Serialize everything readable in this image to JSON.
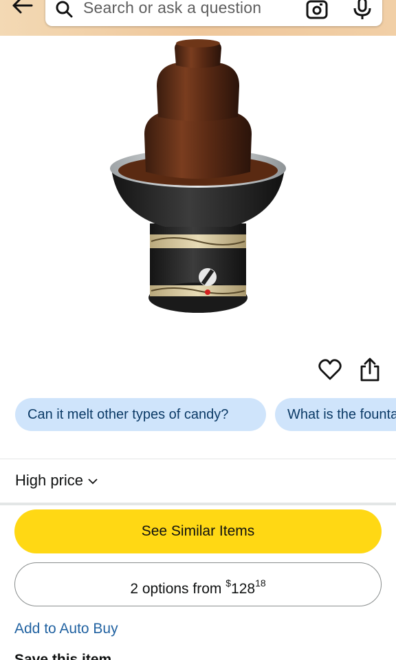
{
  "header": {
    "search_placeholder": "Search or ask a question"
  },
  "chips": [
    {
      "label": "Can it melt other types of candy?"
    },
    {
      "label": "What is the fountain"
    }
  ],
  "price_filter": {
    "label": "High price"
  },
  "buttons": {
    "see_similar": "See Similar Items",
    "options_prefix": "2 options from ",
    "options_currency": "$",
    "options_whole": "128",
    "options_fraction": "18"
  },
  "links": {
    "auto_buy": "Add to Auto Buy",
    "save_item": "Save this item"
  },
  "colors": {
    "header": "#efc79b",
    "chip": "#cfe4fb",
    "primary_button": "#ffd814",
    "link": "#2162a1"
  },
  "icons": [
    "back-arrow-icon",
    "search-icon",
    "camera-icon",
    "mic-icon",
    "heart-icon",
    "share-icon",
    "chevron-down-icon"
  ]
}
